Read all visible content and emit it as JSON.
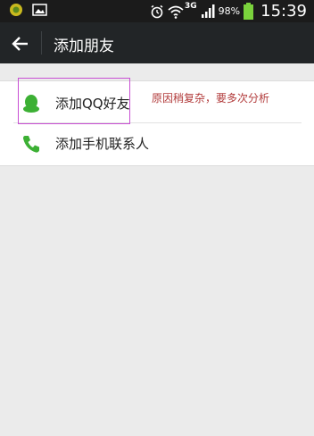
{
  "status_bar": {
    "network_type": "3G",
    "battery_percent": "98%",
    "time": "15:39"
  },
  "app_bar": {
    "title": "添加朋友"
  },
  "list": {
    "items": [
      {
        "label": "添加QQ好友",
        "icon": "qq-penguin-icon"
      },
      {
        "label": "添加手机联系人",
        "icon": "phone-icon"
      }
    ]
  },
  "annotation": {
    "text": "原因稍复杂，要多次分析"
  },
  "colors": {
    "status_bar_bg": "#1b1b1b",
    "app_bar_bg": "#222527",
    "page_bg": "#ebebeb",
    "icon_green": "#3cb034",
    "annotation_border": "#c84fd3",
    "annotation_text": "#b23b3b"
  }
}
